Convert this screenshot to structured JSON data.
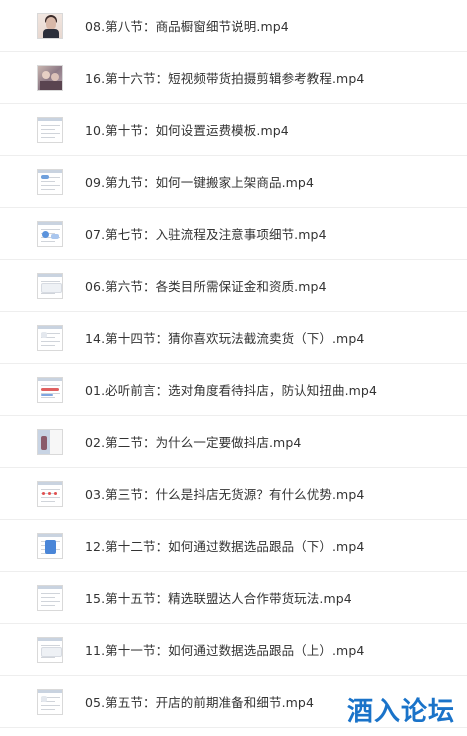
{
  "files": [
    {
      "name": "08.第八节：商品橱窗细节说明.mp4",
      "thumb": "photo-person"
    },
    {
      "name": "16.第十六节：短视频带货拍摄剪辑参考教程.mp4",
      "thumb": "photo-group"
    },
    {
      "name": "10.第十节：如何设置运费模板.mp4",
      "thumb": "doc"
    },
    {
      "name": "09.第九节：如何一键搬家上架商品.mp4",
      "thumb": "doc-blue"
    },
    {
      "name": "07.第七节：入驻流程及注意事项细节.mp4",
      "thumb": "doc-diagram"
    },
    {
      "name": "06.第六节：各类目所需保证金和资质.mp4",
      "thumb": "doc-table"
    },
    {
      "name": "14.第十四节：猜你喜欢玩法截流卖货（下）.mp4",
      "thumb": "doc-light"
    },
    {
      "name": "01.必听前言：选对角度看待抖店，防认知扭曲.mp4",
      "thumb": "doc-red"
    },
    {
      "name": "02.第二节：为什么一定要做抖店.mp4",
      "thumb": "split-photo"
    },
    {
      "name": "03.第三节：什么是抖店无货源？有什么优势.mp4",
      "thumb": "doc-red-dots"
    },
    {
      "name": "12.第十二节：如何通过数据选品跟品（下）.mp4",
      "thumb": "doc-blue-block"
    },
    {
      "name": "15.第十五节：精选联盟达人合作带货玩法.mp4",
      "thumb": "doc"
    },
    {
      "name": "11.第十一节：如何通过数据选品跟品（上）.mp4",
      "thumb": "doc-table"
    },
    {
      "name": "05.第五节：开店的前期准备和细节.mp4",
      "thumb": "doc-light"
    }
  ],
  "watermark": {
    "text": "酒入论坛",
    "color": "#1a73c9"
  }
}
